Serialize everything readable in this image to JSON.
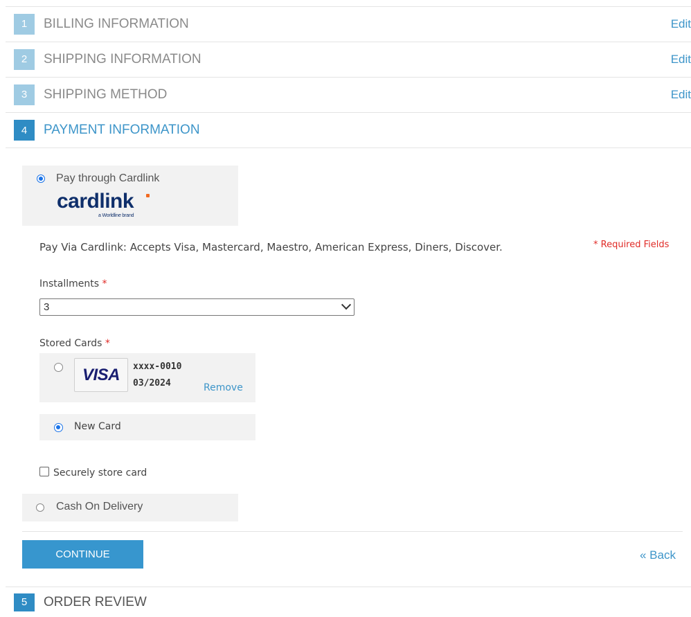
{
  "steps": [
    {
      "num": "1",
      "title": "BILLING INFORMATION",
      "edit": "Edit"
    },
    {
      "num": "2",
      "title": "SHIPPING INFORMATION",
      "edit": "Edit"
    },
    {
      "num": "3",
      "title": "SHIPPING METHOD",
      "edit": "Edit"
    },
    {
      "num": "4",
      "title": "PAYMENT INFORMATION"
    },
    {
      "num": "5",
      "title": "ORDER REVIEW"
    }
  ],
  "payment": {
    "cardlink_label": "Pay through Cardlink",
    "cardlink_logo": "cardlink",
    "cardlink_tagline": "a Worldline brand",
    "description": "Pay Via Cardlink: Accepts Visa, Mastercard, Maestro, American Express, Diners, Discover.",
    "required_fields": "* Required Fields",
    "installments_label": "Installments",
    "installments_value": "3",
    "stored_cards_label": "Stored Cards",
    "stored_card": {
      "brand": "VISA",
      "number": "xxxx-0010",
      "expiry": "03/2024",
      "remove": "Remove"
    },
    "new_card_label": "New Card",
    "store_card_label": "Securely store card",
    "cod_label": "Cash On Delivery",
    "required_mark": "*"
  },
  "actions": {
    "continue": "CONTINUE",
    "back": "« Back"
  },
  "colors": {
    "accent": "#3796ce",
    "required": "#e02b27",
    "visa": "#1a1f71",
    "cardlink_blue": "#0f2f6b",
    "cardlink_dot": "#f26a21"
  }
}
